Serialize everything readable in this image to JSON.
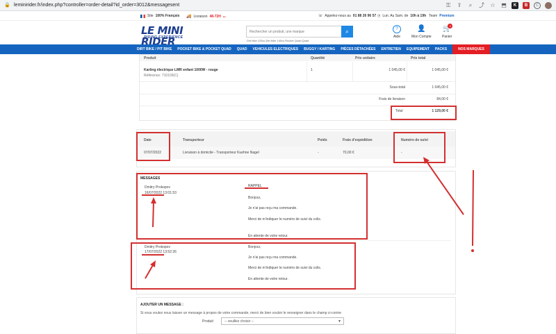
{
  "browser": {
    "url": "leminirider.fr/index.php?controller=order-detail?id_order=3012&messagesent"
  },
  "topbar": {
    "site_prefix": "Site",
    "site_bold": "100% Français",
    "delivery_prefix": "Livraison",
    "delivery_value": "48-72H",
    "delivery_sup": "(1)",
    "phone_prefix": "Appelez-nous au",
    "phone_number": "01 88 26 96 57",
    "hours_prefix": "Lun. Au Sam. de",
    "hours_bold": "10h à 19h",
    "team_prefix": "Team",
    "team_bold": "Premium"
  },
  "header": {
    "logo_word": "LE MINI RIDER",
    "logo_tag": "RIDING EXPERIENCE",
    "search_placeholder": "Rechercher un produit, une marque",
    "search_hint": "Dirt bike 125cc,Dirt bike 140cc,Rocket Quad,Quad",
    "help_label": "Aide",
    "account_label": "Mon Compte",
    "cart_label": "Panier",
    "cart_count": "0"
  },
  "nav": {
    "items": [
      "DIRT BIKE / PIT BIKE",
      "POCKET BIKE & POCKET QUAD",
      "QUAD",
      "VEHICULES ELECTRIQUES",
      "BUGGY / KARTING",
      "PIÈCES DÉTACHÉES",
      "ENTRETIEN",
      "EQUIPEMENT",
      "PACKS"
    ],
    "hot_item": "NOS MARQUES"
  },
  "products": {
    "headers": [
      "Produit",
      "Quantité",
      "Prix unitaire",
      "Prix total"
    ],
    "row": {
      "name": "Karting électrique LMR enfant 1000W - rouge",
      "ref": "Référence: 710109(C)",
      "qty": "1",
      "unit": "1 045,00 €",
      "total": "1 045,00 €"
    },
    "subtotal_label": "Sous-total",
    "subtotal_value": "1 045,00 €",
    "shipping_label": "Frais de livraison",
    "shipping_value": "84,00 €",
    "total_label": "Total",
    "total_value": "1 129,00 €"
  },
  "shipping": {
    "headers": [
      "Date",
      "Transporteur",
      "Poids",
      "Frais d'expédition",
      "Numéro de suivi"
    ],
    "row": [
      "07/07/2022",
      "Livraison à domicile - Transporteur Kuehne Nagel",
      "-",
      "70,00 €",
      "-"
    ]
  },
  "messages": {
    "title": "MESSAGES",
    "items": [
      {
        "author": "Dmitry Prokopov",
        "date": "16/07/2022 13:01:53",
        "lines": [
          "RAPPEL",
          "Bonjour,",
          "Je n'ai pas reçu ma commande.",
          "Merci de m'indiquer le numéro de suivi du colis.",
          "En attente de votre retour."
        ]
      },
      {
        "author": "Dmitry Prokopov",
        "date": "17/07/2022 13:52:26",
        "lines": [
          "Bonjour,",
          "Je n'ai pas reçu ma commande.",
          "Merci de m'indiquer le numéro de suivi du colis.",
          "En attente de votre retour."
        ]
      }
    ]
  },
  "add_message": {
    "title": "AJOUTER UN MESSAGE :",
    "intro": "Si vous voulez nous laisser un message à propos de votre commande, merci de bien vouloir le renseigner dans le champ ci-contre",
    "product_label": "Produit",
    "select_value": "-- veuillez choisir --"
  },
  "colors": {
    "nav_blue": "#1565c0",
    "accent_red": "#e31e24",
    "annotation_red": "#d32f2f",
    "logo_blue": "#1d3f8f"
  }
}
